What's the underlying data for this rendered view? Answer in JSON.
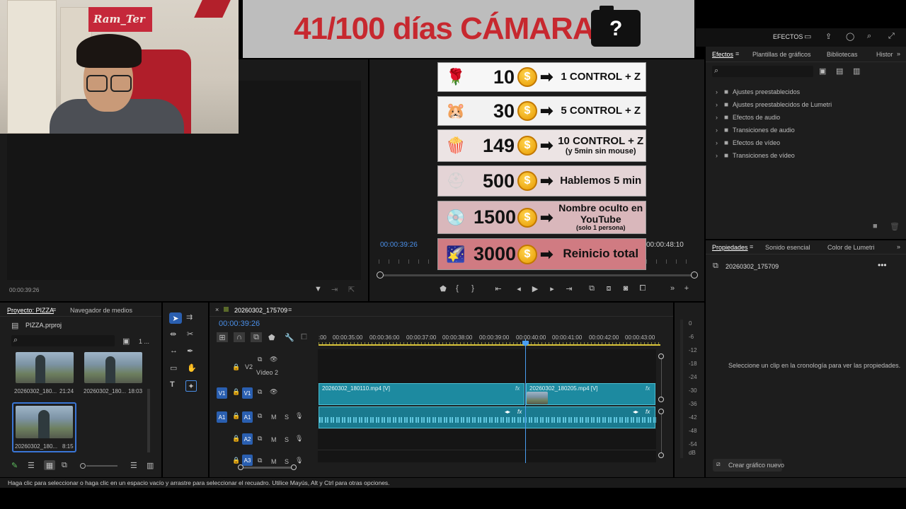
{
  "overlay": {
    "title": "41/100 días CÁMARA",
    "camera_glyph": "?",
    "rewards": [
      {
        "emoji": "🌹",
        "amount": "10",
        "coin": "$",
        "text": "1 CONTROL + Z",
        "sub": ""
      },
      {
        "emoji": "🐹",
        "amount": "30",
        "coin": "$",
        "text": "5 CONTROL + Z",
        "sub": ""
      },
      {
        "emoji": "🍿",
        "amount": "149",
        "coin": "$",
        "text": "10 CONTROL + Z",
        "sub": "(y 5min sin mouse)"
      },
      {
        "emoji": "⛑",
        "amount": "500",
        "coin": "$",
        "text": "Hablemos 5 min",
        "sub": ""
      },
      {
        "emoji": "💿",
        "amount": "1500",
        "coin": "$",
        "text": "Nombre oculto en YouTube",
        "sub": "(solo 1 persona)"
      },
      {
        "emoji": "🌠",
        "amount": "3000",
        "coin": "$",
        "text": "Reinicio total",
        "sub": ""
      }
    ],
    "webcam_sign": "Ram_Ter"
  },
  "program_monitor": {
    "timecode_current": "00:00:39:26",
    "timecode_duration": "00:00:48:10"
  },
  "source_monitor": {
    "timecode": "00:00:39:26"
  },
  "header": {
    "workspace": "EFECTOS"
  },
  "effects_panel": {
    "tabs": [
      "Efectos",
      "Plantillas de gráficos",
      "Bibliotecas",
      "Histor"
    ],
    "folders": [
      "Ajustes preestablecidos",
      "Ajustes preestablecidos de Lumetri",
      "Efectos de audio",
      "Transiciones de audio",
      "Efectos de vídeo",
      "Transiciones de vídeo"
    ]
  },
  "properties_panel": {
    "tabs": [
      "Propiedades",
      "Sonido esencial",
      "Color de Lumetri"
    ],
    "clip_name": "20260302_175709",
    "empty_message": "Seleccione un clip en la cronología para ver las propiedades.",
    "create_graphic": "Crear gráfico nuevo"
  },
  "project_panel": {
    "tabs": [
      "Proyecto: PIZZA",
      "Navegador de medios"
    ],
    "file": "PIZZA.prproj",
    "count": "1 ...",
    "items": [
      {
        "name": "20260302_180...",
        "duration": "21:24"
      },
      {
        "name": "20260302_180...",
        "duration": "18:03"
      },
      {
        "name": "20260302_180...",
        "duration": "8:15"
      }
    ]
  },
  "timeline": {
    "sequence_name": "20260302_175709",
    "timecode": "00:00:39:26",
    "ruler": [
      "00:00:35:00",
      "00:00:36:00",
      "00:00:37:00",
      "00:00:38:00",
      "00:00:39:00",
      "00:00:40:00",
      "00:00:41:00",
      "00:00:42:00",
      "00:00:43:00"
    ],
    "ruler_lead": ":00",
    "tracks": {
      "v2": "V2",
      "v2_name": "Vídeo 2",
      "v1": "V1",
      "a1": "A1",
      "a2": "A2",
      "a3": "A3"
    },
    "clips": {
      "v1_a": "20260302_180110.mp4 [V]",
      "v1_b": "20260302_180205.mp4 [V]"
    }
  },
  "meter": {
    "scale": [
      "0",
      "-6",
      "-12",
      "-18",
      "-24",
      "-30",
      "-36",
      "-42",
      "-48",
      "-54",
      "dB"
    ]
  },
  "status_bar": {
    "text": "Haga clic para seleccionar o haga clic en un espacio vacío y arrastre para seleccionar el recuadro. Utilice Mayús, Alt y Ctrl para otras opciones."
  },
  "colors": {
    "accent_blue": "#2a5fb0",
    "timecode_blue": "#4a8fe8",
    "clip_teal": "#1d8aa0",
    "banner_red": "#c7282f"
  }
}
